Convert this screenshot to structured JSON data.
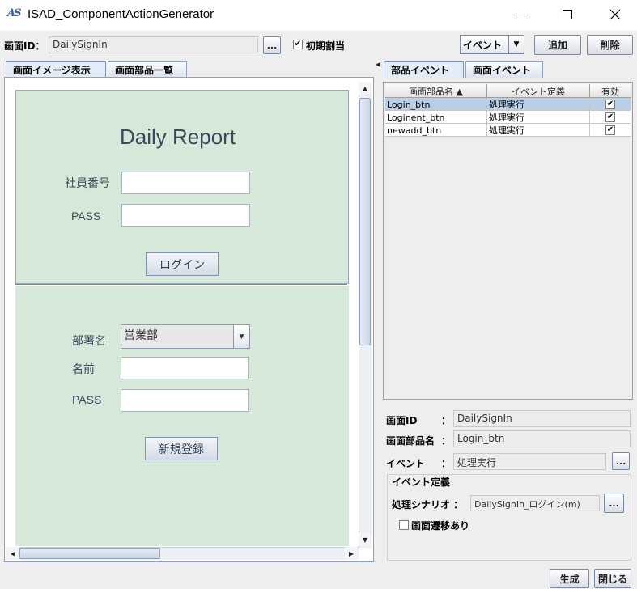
{
  "window": {
    "title": "ISAD_ComponentActionGenerator",
    "logo_text": "AS"
  },
  "toolbar": {
    "screen_id_label": "画面ID：",
    "screen_id_value": "DailySignIn",
    "browse_label": "...",
    "initial_assign_label": "初期割当",
    "initial_assign_checked": true,
    "event_select_value": "イベント",
    "add_label": "追加",
    "delete_label": "削除"
  },
  "left_tabs": [
    {
      "label": "画面イメージ表示",
      "active": true
    },
    {
      "label": "画面部品一覧",
      "active": false
    }
  ],
  "preview": {
    "title": "Daily Report",
    "section1": {
      "employee_no_label": "社員番号",
      "pass_label": "PASS",
      "login_button": "ログイン"
    },
    "section2": {
      "dept_label": "部署名",
      "dept_value": "営業部",
      "name_label": "名前",
      "pass_label": "PASS",
      "register_button": "新規登録"
    }
  },
  "right_tabs": [
    {
      "label": "部品イベント",
      "active": true
    },
    {
      "label": "画面イベント",
      "active": false
    }
  ],
  "event_table": {
    "columns": [
      "画面部品名 ▲",
      "イベント定義",
      "有効"
    ],
    "rows": [
      {
        "part": "Login_btn",
        "event": "処理実行",
        "enabled": "✔",
        "selected": true
      },
      {
        "part": "Loginent_btn",
        "event": "処理実行",
        "enabled": "✔",
        "selected": false
      },
      {
        "part": "newadd_btn",
        "event": "処理実行",
        "enabled": "✔",
        "selected": false
      }
    ]
  },
  "detail": {
    "screen_id_label": "画面ID",
    "screen_id_value": "DailySignIn",
    "part_name_label": "画面部品名",
    "part_name_value": "Login_btn",
    "event_label": "イベント",
    "event_value": "処理実行",
    "colon": "：",
    "browse_label": "...",
    "group_title": "イベント定義",
    "scenario_label": "処理シナリオ ：",
    "scenario_value": "DailySignIn_ログイン(m)",
    "transition_label": "画面遷移あり",
    "transition_checked": false
  },
  "footer": {
    "generate_label": "生成",
    "close_label": "閉じる"
  }
}
